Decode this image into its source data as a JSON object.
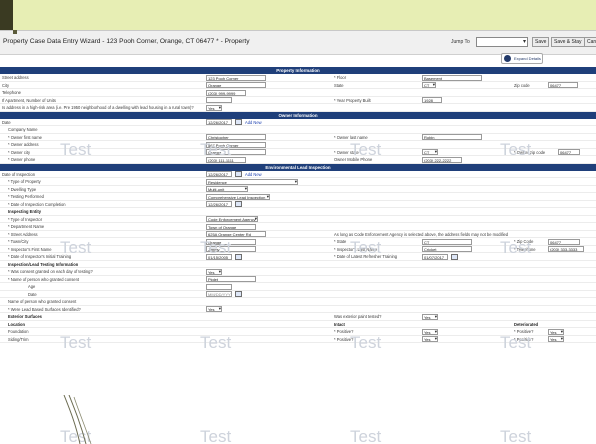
{
  "window": {
    "title": "Property Case Data Entry Wizard - 123 Pooh Corner, Orange, CT 06477 * - Property",
    "jump_label": "Jump To",
    "jump_value": "",
    "buttons": [
      "Save",
      "Save & Stay",
      "Canc"
    ],
    "expand_details": "Expand Details"
  },
  "watermark": "Test",
  "colors": {
    "section_header": "#1f3f7a",
    "link": "#1b3fb0",
    "slide_accent": "#e7eeb4"
  },
  "sections": {
    "property": "Property Information",
    "owner": "Owner Information",
    "inspection": "Environmental Lead Inspection"
  },
  "property": {
    "street_label": "Street address",
    "street_value": "123 Pooh Corner",
    "floor_label": "* Floor",
    "floor_value": "Basement",
    "city_label": "City",
    "city_value": "Orange",
    "state_label": "State",
    "state_value": "CT",
    "zip_label": "Zip code",
    "zip_value": "06477",
    "phone_label": "Telephone",
    "phone_value": "(203) 999-9999",
    "units_label": "If Apartment, Number of Units",
    "year_label": "* Year Property Built",
    "year_value": "1928",
    "highrisk_label": "Is address in a high-risk area (i.e. Pre 1950 neighborhood of a dwelling with lead housing in a rural town)?",
    "highrisk_value": "Yes"
  },
  "owner": {
    "date_label": "Date",
    "date_value": "12/26/2017",
    "add_new": "Add New",
    "company_label": "Company Name",
    "first_label": "* Owner first name",
    "first_value": "Christopher",
    "last_label": "* Owner last name",
    "last_value": "Robin",
    "address_label": "* Owner address",
    "address_value": "567 Pooh Corner",
    "city_label": "* Owner city",
    "city_value": "Orange",
    "state_label": "* Owner state",
    "state_value": "CT",
    "zip_label": "* Owner zip code",
    "zip_value": "06477",
    "phone_label": "* Owner phone",
    "phone_value": "(203) 111-1111",
    "mobile_label": "Owner Mobile Phone",
    "mobile_value": "(203) 222-2222"
  },
  "inspection": {
    "date_label": "Date of Inspection",
    "date_value": "12/26/2017",
    "add_new": "Add New",
    "type_prop_label": "* Type of Property",
    "type_prop_value": "Residence",
    "dwelling_label": "* Dwelling Type",
    "dwelling_value": "Multi-unit",
    "testing_label": "* Testing Performed",
    "testing_value": "Comprehensive Lead Inspection",
    "date_company_label": "* Date of Inspection Completion",
    "date_company_value": "12/26/2017",
    "entity_heading": "Inspecting Entity",
    "type_insp_label": "* Type of Inspector",
    "type_insp_value": "Code Enforcement Agency",
    "dept_label": "* Department Name",
    "dept_value": "Town of Orange",
    "street_label": "* Street Address",
    "street_value": "625A Orange Center Rd",
    "note": "As long as Code Enforcement Agency is selected above, the address fields may not be modified",
    "town_label": "* Town/City",
    "town_value": "Orange",
    "state_label": "* State",
    "state_value": "CT",
    "zip_label": "* Zip Code",
    "zip_value": "06477",
    "first_label": "* Inspector's First Name",
    "first_value": "Jimmy",
    "last_label": "* Inspector's Last Name",
    "last_value": "Cricket",
    "phone_label": "* Telephone",
    "phone_value": "(203) 333-3333",
    "training_label": "* Date of Inspector's Initial Training",
    "training_value": "01/15/2005",
    "refresher_label": "* Date of Latest Refresher Training",
    "refresher_value": "01/07/2017",
    "info_heading": "Inspection/Lead Testing Information",
    "consent_label": "* Was consent granted on each day of testing?",
    "consent_value": "Yes",
    "consent_name_label": "* Name of person who granted consent",
    "consent_name_value": "Piglet",
    "age_label": "Age",
    "date_label2": "Date",
    "date_value2": "MM/DD/YYYY",
    "name_not_label": "Name of person who granted consent",
    "surfaces_label": "* Were Lead Based Surfaces Identified?",
    "surfaces_value": "Yes",
    "exterior_heading": "Exterior Surfaces",
    "paint_label": "Was exterior paint tested?",
    "paint_value": "Yes",
    "location_col": "Location",
    "intact_col": "Intact",
    "deteriorated_col": "Deteriorated",
    "rows": [
      {
        "location": "Foundation",
        "positive_label": "* Positive?",
        "positive_value": "Yes",
        "positive2_label": "* Positive?",
        "positive2_value": "Yes"
      },
      {
        "location": "Siding/Trim",
        "positive_label": "* Positive?",
        "positive_value": "Yes",
        "positive2_label": "* Positive?",
        "positive2_value": "Yes"
      }
    ]
  }
}
